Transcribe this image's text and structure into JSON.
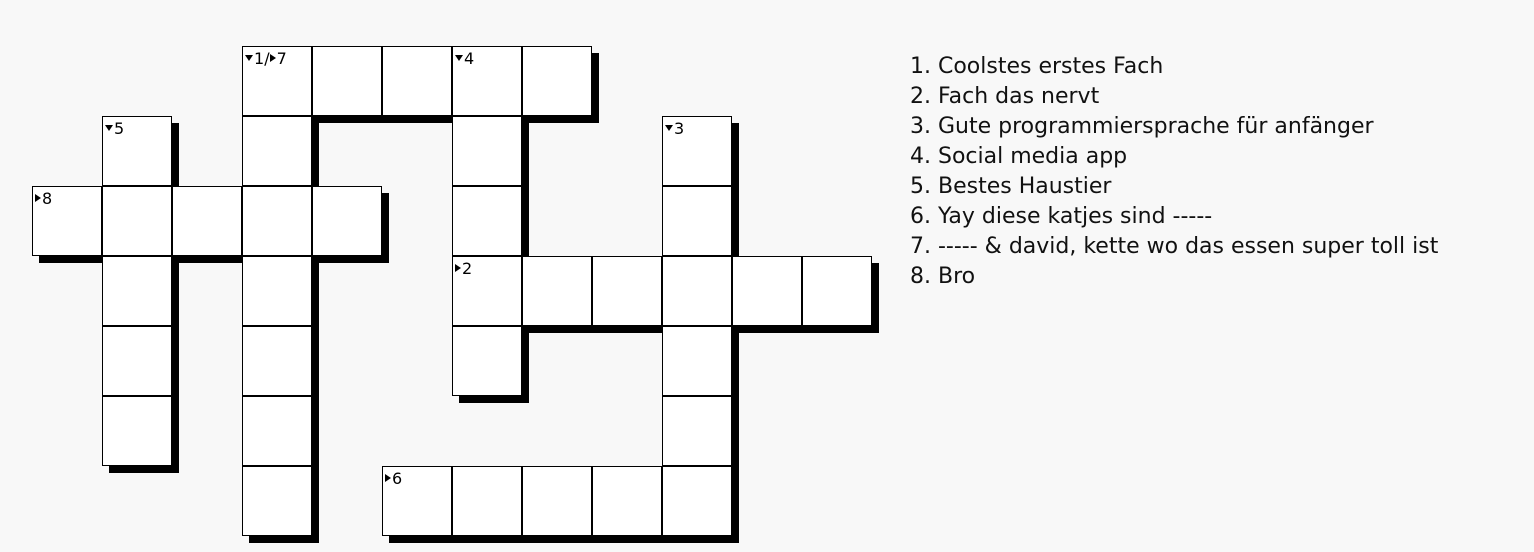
{
  "clue_markers": [
    {
      "cell": [
        0,
        3
      ],
      "parts": [
        {
          "dir": "down",
          "num": "1"
        },
        {
          "sep": "/"
        },
        {
          "dir": "across",
          "num": "7"
        }
      ]
    },
    {
      "cell": [
        0,
        6
      ],
      "parts": [
        {
          "dir": "down",
          "num": "4"
        }
      ]
    },
    {
      "cell": [
        1,
        1
      ],
      "parts": [
        {
          "dir": "down",
          "num": "5"
        }
      ]
    },
    {
      "cell": [
        1,
        9
      ],
      "parts": [
        {
          "dir": "down",
          "num": "3"
        }
      ]
    },
    {
      "cell": [
        2,
        0
      ],
      "parts": [
        {
          "dir": "across",
          "num": "8"
        }
      ]
    },
    {
      "cell": [
        3,
        6
      ],
      "parts": [
        {
          "dir": "across",
          "num": "2"
        }
      ]
    },
    {
      "cell": [
        6,
        5
      ],
      "parts": [
        {
          "dir": "across",
          "num": "6"
        }
      ]
    }
  ],
  "words": [
    {
      "id": "1-down",
      "start": [
        0,
        3
      ],
      "dir": "down",
      "length": 7
    },
    {
      "id": "7-across",
      "start": [
        0,
        3
      ],
      "dir": "across",
      "length": 5
    },
    {
      "id": "4-down",
      "start": [
        0,
        6
      ],
      "dir": "down",
      "length": 5
    },
    {
      "id": "5-down",
      "start": [
        1,
        1
      ],
      "dir": "down",
      "length": 5
    },
    {
      "id": "3-down",
      "start": [
        1,
        9
      ],
      "dir": "down",
      "length": 6
    },
    {
      "id": "8-across",
      "start": [
        2,
        0
      ],
      "dir": "across",
      "length": 5
    },
    {
      "id": "2-across",
      "start": [
        3,
        6
      ],
      "dir": "across",
      "length": 6
    },
    {
      "id": "6-across",
      "start": [
        6,
        5
      ],
      "dir": "across",
      "length": 5
    }
  ],
  "clues": [
    "1. Coolstes erstes Fach",
    "2. Fach das nervt",
    "3. Gute programmiersprache für anfänger",
    "4. Social media app",
    "5. Bestes Haustier",
    "6. Yay diese katjes sind -----",
    "7. ----- & david, kette wo das essen super toll ist",
    "8. Bro"
  ]
}
